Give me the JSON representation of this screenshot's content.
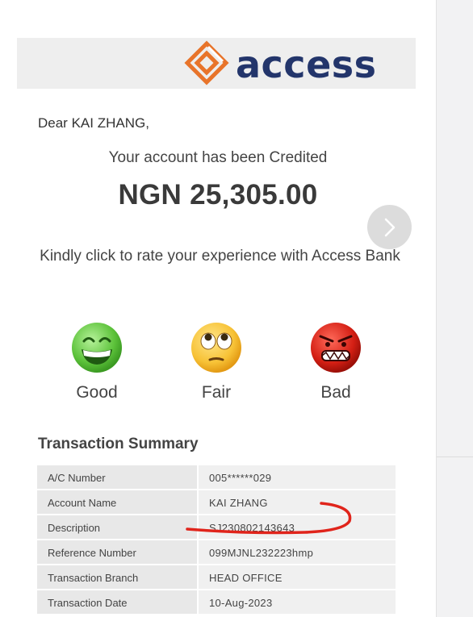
{
  "brand": {
    "name": "access"
  },
  "email": {
    "greeting": "Dear KAI ZHANG,",
    "credited_text": "Your account has been Credited",
    "amount": "NGN 25,305.00",
    "rate_prompt": "Kindly click to rate your experience with Access Bank"
  },
  "ratings": [
    {
      "label": "Good"
    },
    {
      "label": "Fair"
    },
    {
      "label": "Bad"
    }
  ],
  "summary": {
    "title": "Transaction Summary",
    "rows": [
      {
        "label": "A/C Number",
        "value": "005******029"
      },
      {
        "label": "Account Name",
        "value": "KAI ZHANG"
      },
      {
        "label": "Description",
        "value": "SJ230802143643"
      },
      {
        "label": "Reference Number",
        "value": "099MJNL232223hmp"
      },
      {
        "label": "Transaction Branch",
        "value": "HEAD OFFICE"
      },
      {
        "label": "Transaction Date",
        "value": "10-Aug-2023"
      }
    ]
  },
  "colors": {
    "brand_orange": "#e8742a",
    "brand_navy": "#23356b",
    "annotation_red": "#e0241b"
  },
  "icons": {
    "next": "chevron-right-icon",
    "good": "grinning-face-icon",
    "fair": "eye-roll-face-icon",
    "bad": "angry-face-icon"
  }
}
